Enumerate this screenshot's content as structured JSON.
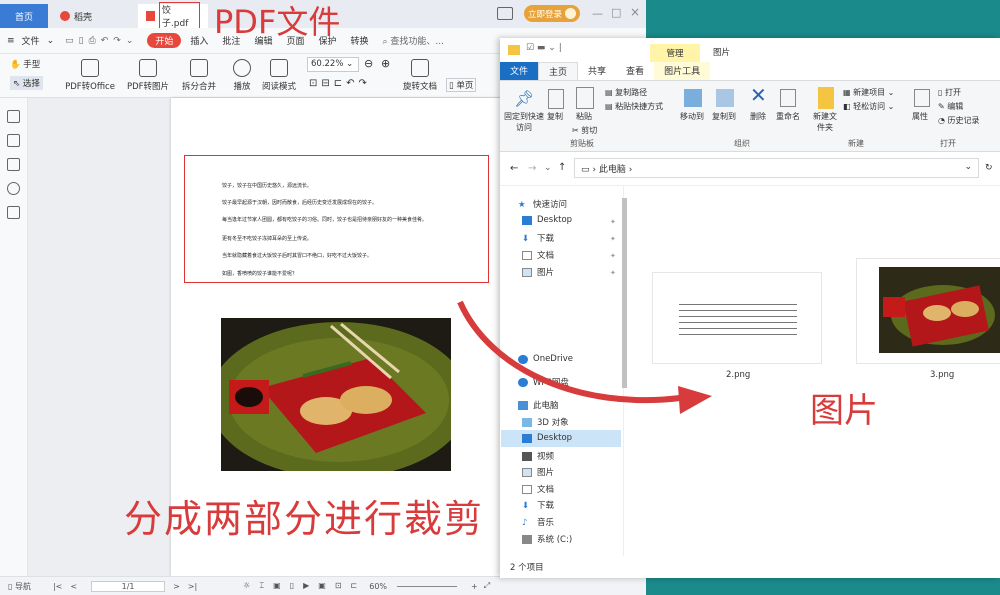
{
  "pdf_editor": {
    "tabs": {
      "home": "首页",
      "app": "稻壳",
      "file": "饺子.pdf"
    },
    "login": "立即登录",
    "menu": [
      "文件",
      "开始",
      "插入",
      "批注",
      "编辑",
      "页面",
      "保护",
      "转换"
    ],
    "search": "查找功能、...",
    "ribbon": {
      "hand": "手型",
      "select": "选择",
      "to_office": "PDF转Office",
      "to_image": "PDF转图片",
      "split_merge": "拆分合并",
      "play": "播放",
      "read_mode": "阅读模式",
      "zoom": "60.22%",
      "rotate": "旋转文档",
      "single": "单页"
    },
    "doc_lines": [
      "饺子，饺子在中国历史悠久，源远流长。",
      "饺子最早起源于汉朝，因时而散食，后经历史变迁发展成现在的饺子。",
      "每当逢年过节家人团圆，都有吃饺子的习俗。同时，饺子也是招待亲朋好友的一种美食佳肴。",
      "更有冬至不吃饺子冻掉耳朵的至上传说。",
      "当年就隐藏着食过大饭饺子后时其冒口不绝口，好吃不过大饭饺子。",
      "如图，香喷喷的饺子谁能不爱呢？"
    ],
    "status": {
      "nav": "导航",
      "page": "1/1",
      "zoom": "60%"
    }
  },
  "explorer": {
    "title_tabs": {
      "manage": "管理",
      "pictures": "图片"
    },
    "tabs": [
      "文件",
      "主页",
      "共享",
      "查看",
      "图片工具"
    ],
    "ribbon": {
      "pin": "固定到快速访问",
      "copy": "复制",
      "paste": "粘贴",
      "copy_path": "复制路径",
      "paste_shortcut": "粘贴快捷方式",
      "cut": "剪切",
      "move_to": "移动到",
      "copy_to": "复制到",
      "delete": "删除",
      "rename": "重命名",
      "new_folder": "新建文件夹",
      "new_item": "新建项目",
      "easy_access": "轻松访问",
      "properties": "属性",
      "open": "打开",
      "edit": "编辑",
      "history": "历史记录",
      "groups": {
        "clipboard": "剪贴板",
        "organize": "组织",
        "new": "新建",
        "open": "打开"
      }
    },
    "address": "此电脑",
    "nav": [
      "快速访问",
      "Desktop",
      "下载",
      "文档",
      "图片",
      "OneDrive",
      "WPS网盘",
      "此电脑",
      "3D 对象",
      "Desktop",
      "视频",
      "图片",
      "文档",
      "下载",
      "音乐",
      "系统 (C:)"
    ],
    "files": [
      {
        "name": "2.png"
      },
      {
        "name": "3.png"
      }
    ],
    "status": "2 个项目"
  },
  "callouts": {
    "pdf_file": "PDF文件",
    "images": "图片",
    "crop": "分成两部分进行裁剪"
  },
  "colors": {
    "accent_red": "#d83b3b",
    "wps_red": "#e8483b",
    "teal_bg": "#1a8a8a"
  }
}
